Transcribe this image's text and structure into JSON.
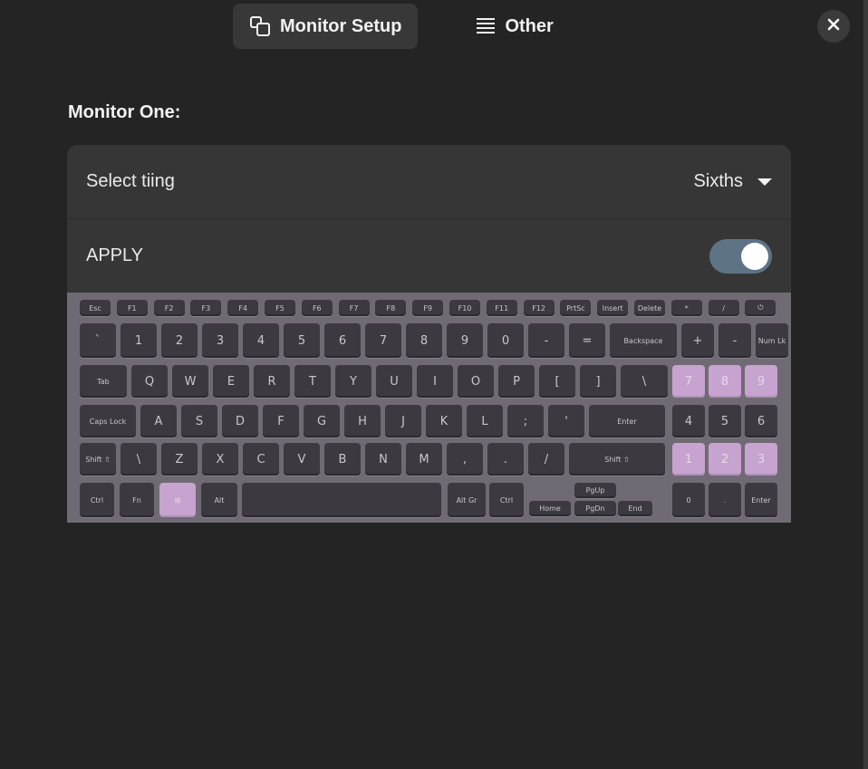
{
  "header": {
    "tabs": [
      {
        "label": "Monitor Setup",
        "icon": "monitors-icon",
        "active": true
      },
      {
        "label": "Other",
        "icon": "list-icon",
        "active": false
      }
    ],
    "close_icon": "close-icon"
  },
  "main": {
    "section_title": "Monitor One:",
    "tiling": {
      "label": "Select tiing",
      "value": "Sixths"
    },
    "apply": {
      "label": "APPLY",
      "enabled": true
    },
    "keyboard_image": {
      "description_icon": "keyboard-photo",
      "highlight_color": "#c7a3cf",
      "keys": {
        "fn_row": [
          "Esc",
          "F1",
          "F2",
          "F3",
          "F4",
          "F5",
          "F6",
          "F7",
          "F8",
          "F9",
          "F10",
          "F11",
          "F12",
          "PrtSc",
          "Insert",
          "Delete",
          "*",
          "/",
          "⏻"
        ],
        "num_row": [
          "`",
          "1",
          "2",
          "3",
          "4",
          "5",
          "6",
          "7",
          "8",
          "9",
          "0",
          "-",
          "=",
          "Backspace",
          "+",
          "-",
          "Num Lk"
        ],
        "top_row": [
          "Tab",
          "Q",
          "W",
          "E",
          "R",
          "T",
          "Y",
          "U",
          "I",
          "O",
          "P",
          "[",
          "]",
          "\\",
          "7",
          "8",
          "9"
        ],
        "home_row": [
          "Caps Lock",
          "A",
          "S",
          "D",
          "F",
          "G",
          "H",
          "J",
          "K",
          "L",
          ";",
          "'",
          "Enter",
          "4",
          "5",
          "6"
        ],
        "bottom_row": [
          "Shift ⇧",
          "\\",
          "Z",
          "X",
          "C",
          "V",
          "B",
          "N",
          "M",
          ",",
          ".",
          "/",
          "Shift ⇧",
          "1",
          "2",
          "3"
        ],
        "space_row": [
          "Ctrl",
          "Fn",
          "⊞",
          "Alt",
          "",
          "Alt Gr",
          "Ctrl",
          "Home",
          "PgUp",
          "PgDn",
          "End",
          "0",
          ".",
          "Enter"
        ]
      }
    }
  }
}
